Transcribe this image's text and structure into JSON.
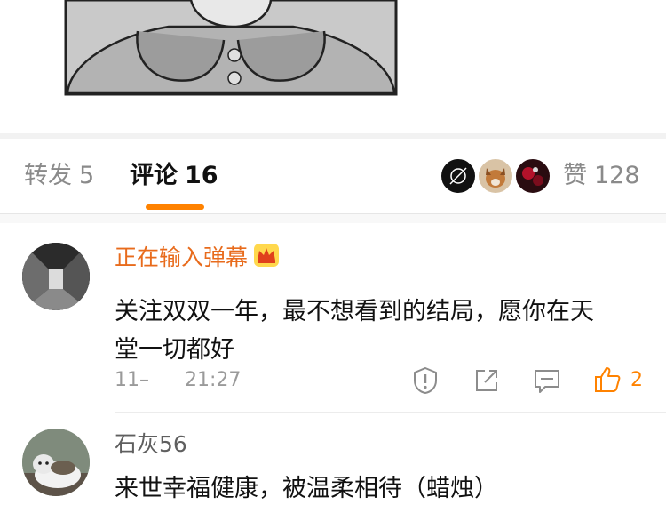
{
  "tabs": {
    "repost": {
      "label": "转发",
      "count": "5"
    },
    "comments": {
      "label": "评论",
      "count": "16"
    },
    "likes": {
      "label": "赞",
      "count": "128"
    }
  },
  "accent_color": "#ff8200",
  "comments": [
    {
      "username": "正在输入弹幕",
      "vip_badge": "crown-icon",
      "text": "关注双双一年，最不想看到的结局，愿你在天堂一切都好",
      "date": "11–",
      "time": "21:27",
      "like_count": "2",
      "liked": true
    },
    {
      "username": "石灰56",
      "text": "来世幸福健康，被温柔相待（蜡烛）",
      "like_count": "",
      "liked": false
    }
  ],
  "icons": [
    "report-icon",
    "share-icon",
    "reply-icon",
    "like-thumb-icon"
  ]
}
